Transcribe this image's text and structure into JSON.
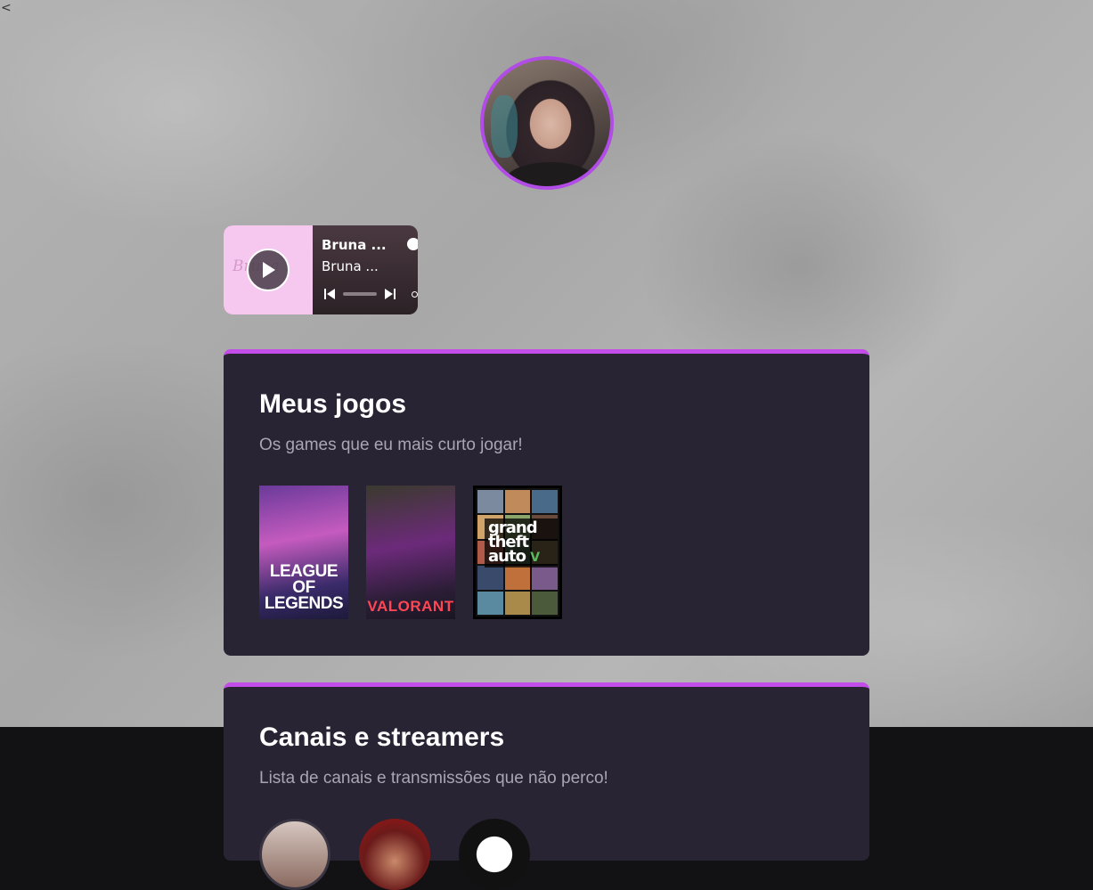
{
  "nav": {
    "back_label": "<"
  },
  "profile": {
    "avatar_alt": "profile photo"
  },
  "player": {
    "cover_text": "Bruna",
    "track_title": "Bruna ...",
    "track_artist": "Bruna ...",
    "icons": [
      "play-icon",
      "previous-icon",
      "next-icon",
      "spotify-icon"
    ]
  },
  "games_section": {
    "title": "Meus jogos",
    "subtitle": "Os games que eu mais curto jogar!",
    "games": [
      {
        "name": "League of Legends",
        "logo_text": "LEAGUE OF LEGENDS"
      },
      {
        "name": "Valorant",
        "logo_text": "VALORANT"
      },
      {
        "name": "Grand Theft Auto V",
        "logo_text": "grand theft auto",
        "logo_numeral": "V"
      }
    ]
  },
  "streamers_section": {
    "title": "Canais e streamers",
    "subtitle": "Lista de canais e transmissões que não perco!"
  },
  "colors": {
    "accent": "#c24de8",
    "card_bg": "#282434",
    "footer_bg": "#121114",
    "player_cover": "#f6c7ef"
  }
}
